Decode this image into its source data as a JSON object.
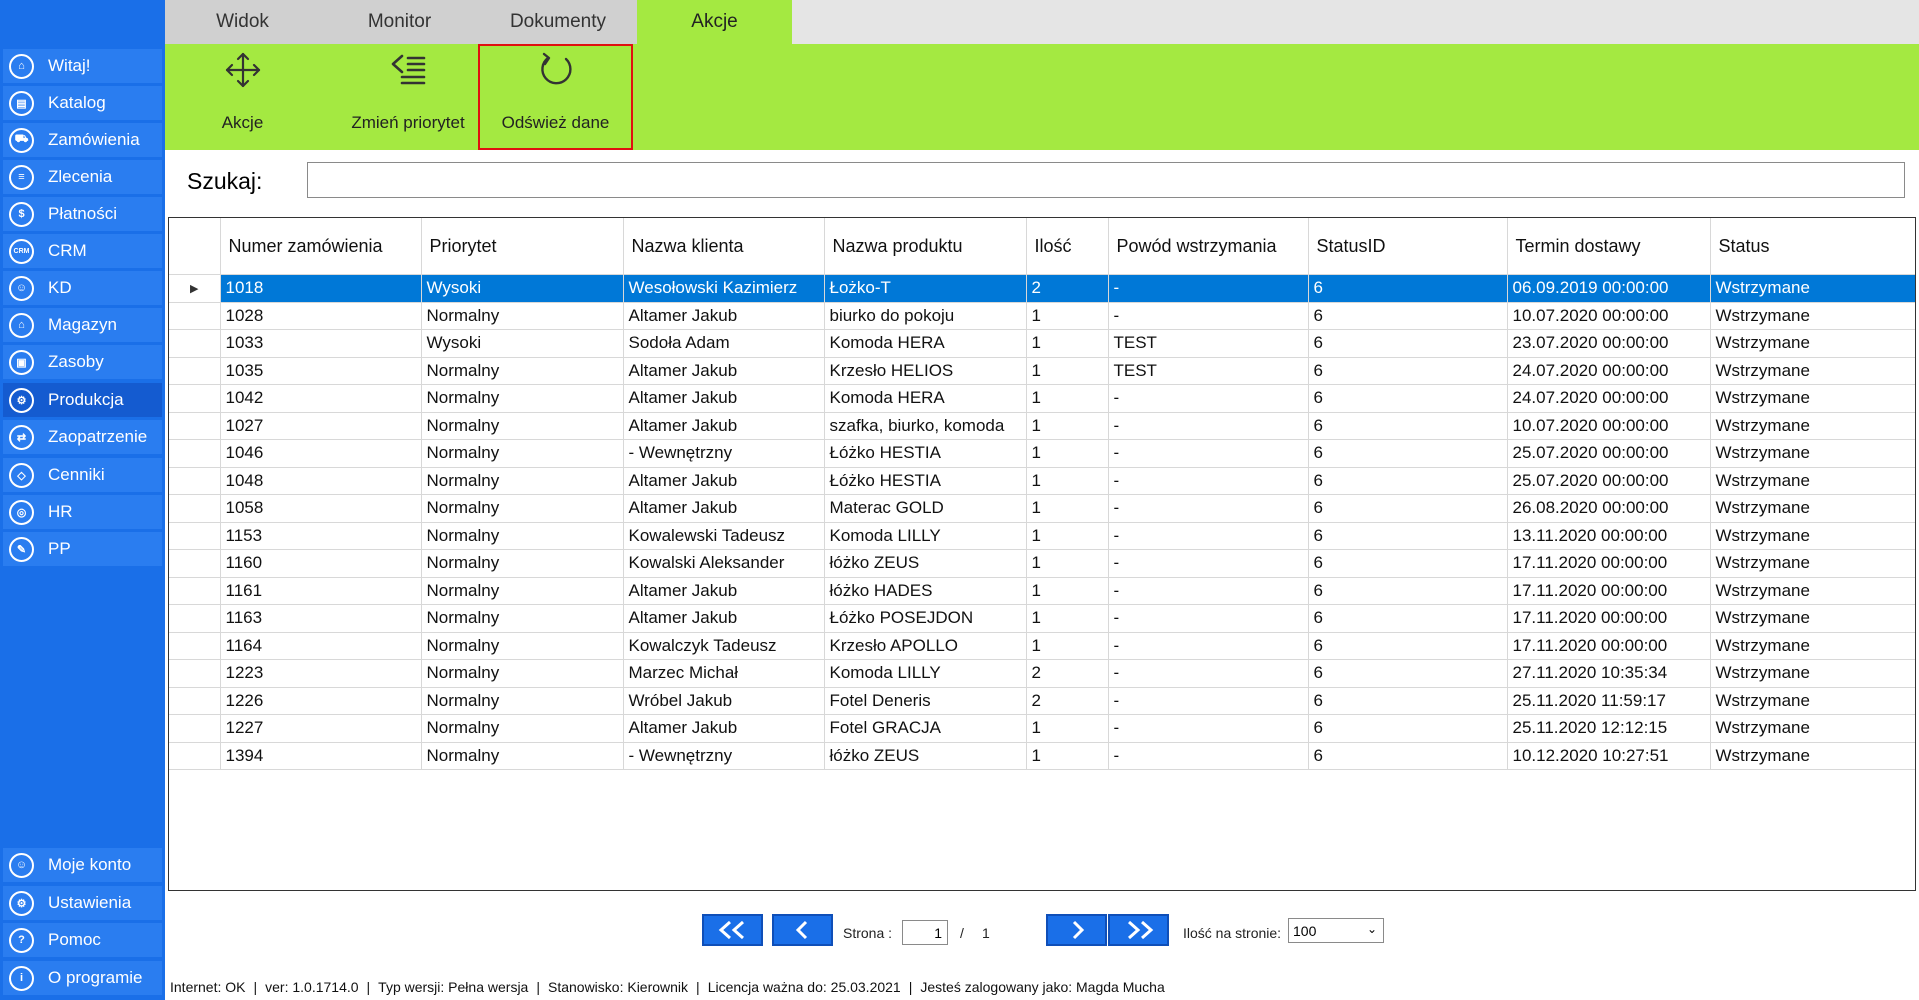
{
  "sidebar": {
    "items": [
      {
        "label": "Witaj!",
        "icon": "home-icon"
      },
      {
        "label": "Katalog",
        "icon": "book-icon"
      },
      {
        "label": "Zamówienia",
        "icon": "cart-icon"
      },
      {
        "label": "Zlecenia",
        "icon": "list-icon"
      },
      {
        "label": "Płatności",
        "icon": "dollar-icon"
      },
      {
        "label": "CRM",
        "icon": "crm-icon"
      },
      {
        "label": "KD",
        "icon": "user-icon"
      },
      {
        "label": "Magazyn",
        "icon": "warehouse-icon"
      },
      {
        "label": "Zasoby",
        "icon": "box-icon"
      },
      {
        "label": "Produkcja",
        "icon": "production-icon"
      },
      {
        "label": "Zaopatrzenie",
        "icon": "truck-icon"
      },
      {
        "label": "Cenniki",
        "icon": "tag-icon"
      },
      {
        "label": "HR",
        "icon": "hr-icon"
      },
      {
        "label": "PP",
        "icon": "pp-icon"
      }
    ],
    "bottom_items": [
      {
        "label": "Moje konto",
        "icon": "account-icon"
      },
      {
        "label": "Ustawienia",
        "icon": "settings-icon"
      },
      {
        "label": "Pomoc",
        "icon": "help-icon"
      },
      {
        "label": "O programie",
        "icon": "info-icon"
      }
    ],
    "active": "Produkcja"
  },
  "tabs": [
    {
      "label": "Widok"
    },
    {
      "label": "Monitor"
    },
    {
      "label": "Dokumenty"
    },
    {
      "label": "Akcje"
    }
  ],
  "active_tab": "Akcje",
  "ribbon": {
    "actions_label": "Akcje",
    "priority_label": "Zmień priorytet",
    "refresh_label": "Odśwież dane"
  },
  "search": {
    "label": "Szukaj:",
    "value": ""
  },
  "table": {
    "columns": [
      "Numer zamówienia",
      "Priorytet",
      "Nazwa klienta",
      "Nazwa produktu",
      "Ilość",
      "Powód wstrzymania",
      "StatusID",
      "Termin dostawy",
      "Status"
    ],
    "rows": [
      [
        "1018",
        "Wysoki",
        "Wesołowski Kazimierz",
        "Łożko-T",
        "2",
        "-",
        "6",
        "06.09.2019 00:00:00",
        "Wstrzymane"
      ],
      [
        "1028",
        "Normalny",
        "Altamer Jakub",
        "biurko do pokoju",
        "1",
        "-",
        "6",
        "10.07.2020 00:00:00",
        "Wstrzymane"
      ],
      [
        "1033",
        "Wysoki",
        "Sodoła  Adam",
        "Komoda HERA",
        "1",
        "TEST",
        "6",
        "23.07.2020 00:00:00",
        "Wstrzymane"
      ],
      [
        "1035",
        "Normalny",
        "Altamer Jakub",
        "Krzesło HELIOS",
        "1",
        "TEST",
        "6",
        "24.07.2020 00:00:00",
        "Wstrzymane"
      ],
      [
        "1042",
        "Normalny",
        "Altamer Jakub",
        "Komoda HERA",
        "1",
        "-",
        "6",
        "24.07.2020 00:00:00",
        "Wstrzymane"
      ],
      [
        "1027",
        "Normalny",
        "Altamer Jakub",
        "szafka, biurko, komoda",
        "1",
        "-",
        "6",
        "10.07.2020 00:00:00",
        "Wstrzymane"
      ],
      [
        "1046",
        "Normalny",
        "- Wewnętrzny",
        "Łóżko HESTIA",
        "1",
        "-",
        "6",
        "25.07.2020 00:00:00",
        "Wstrzymane"
      ],
      [
        "1048",
        "Normalny",
        "Altamer Jakub",
        "Łóżko HESTIA",
        "1",
        "-",
        "6",
        "25.07.2020 00:00:00",
        "Wstrzymane"
      ],
      [
        "1058",
        "Normalny",
        "Altamer Jakub",
        "Materac GOLD",
        "1",
        "-",
        "6",
        "26.08.2020 00:00:00",
        "Wstrzymane"
      ],
      [
        "1153",
        "Normalny",
        "Kowalewski Tadeusz",
        "Komoda LILLY",
        "1",
        "-",
        "6",
        "13.11.2020 00:00:00",
        "Wstrzymane"
      ],
      [
        "1160",
        "Normalny",
        "Kowalski Aleksander",
        "łóżko ZEUS",
        "1",
        "-",
        "6",
        "17.11.2020 00:00:00",
        "Wstrzymane"
      ],
      [
        "1161",
        "Normalny",
        "Altamer Jakub",
        "łóżko HADES",
        "1",
        "-",
        "6",
        "17.11.2020 00:00:00",
        "Wstrzymane"
      ],
      [
        "1163",
        "Normalny",
        "Altamer Jakub",
        "Łóżko POSEJDON",
        "1",
        "-",
        "6",
        "17.11.2020 00:00:00",
        "Wstrzymane"
      ],
      [
        "1164",
        "Normalny",
        "Kowalczyk Tadeusz",
        "Krzesło APOLLO",
        "1",
        "-",
        "6",
        "17.11.2020 00:00:00",
        "Wstrzymane"
      ],
      [
        "1223",
        "Normalny",
        "Marzec Michał",
        "Komoda LILLY",
        "2",
        "-",
        "6",
        "27.11.2020 10:35:34",
        "Wstrzymane"
      ],
      [
        "1226",
        "Normalny",
        "Wróbel Jakub",
        "Fotel Deneris",
        "2",
        "-",
        "6",
        "25.11.2020 11:59:17",
        "Wstrzymane"
      ],
      [
        "1227",
        "Normalny",
        "Altamer Jakub",
        "Fotel GRACJA",
        "1",
        "-",
        "6",
        "25.11.2020 12:12:15",
        "Wstrzymane"
      ],
      [
        "1394",
        "Normalny",
        "- Wewnętrzny",
        "łóżko ZEUS",
        "1",
        "-",
        "6",
        "10.12.2020 10:27:51",
        "Wstrzymane"
      ]
    ],
    "selected_row": 0
  },
  "pager": {
    "page_label": "Strona :",
    "current_page": "1",
    "separator": "/",
    "total_pages": "1",
    "per_page_label": "Ilość na stronie:",
    "per_page_value": "100"
  },
  "status_bar": {
    "internet": "Internet: OK",
    "version": "ver: 1.0.1714.0",
    "version_type": "Typ wersji: Pełna wersja",
    "station": "Stanowisko: Kierownik",
    "license": "Licencja ważna do: 25.03.2021",
    "user": "Jesteś zalogowany jako: Magda Mucha",
    "separator": "|"
  },
  "colors": {
    "sidebar": "#1a6fe8",
    "ribbon": "#a4e941",
    "selection": "#0078d7",
    "highlight_box": "#e01010"
  }
}
